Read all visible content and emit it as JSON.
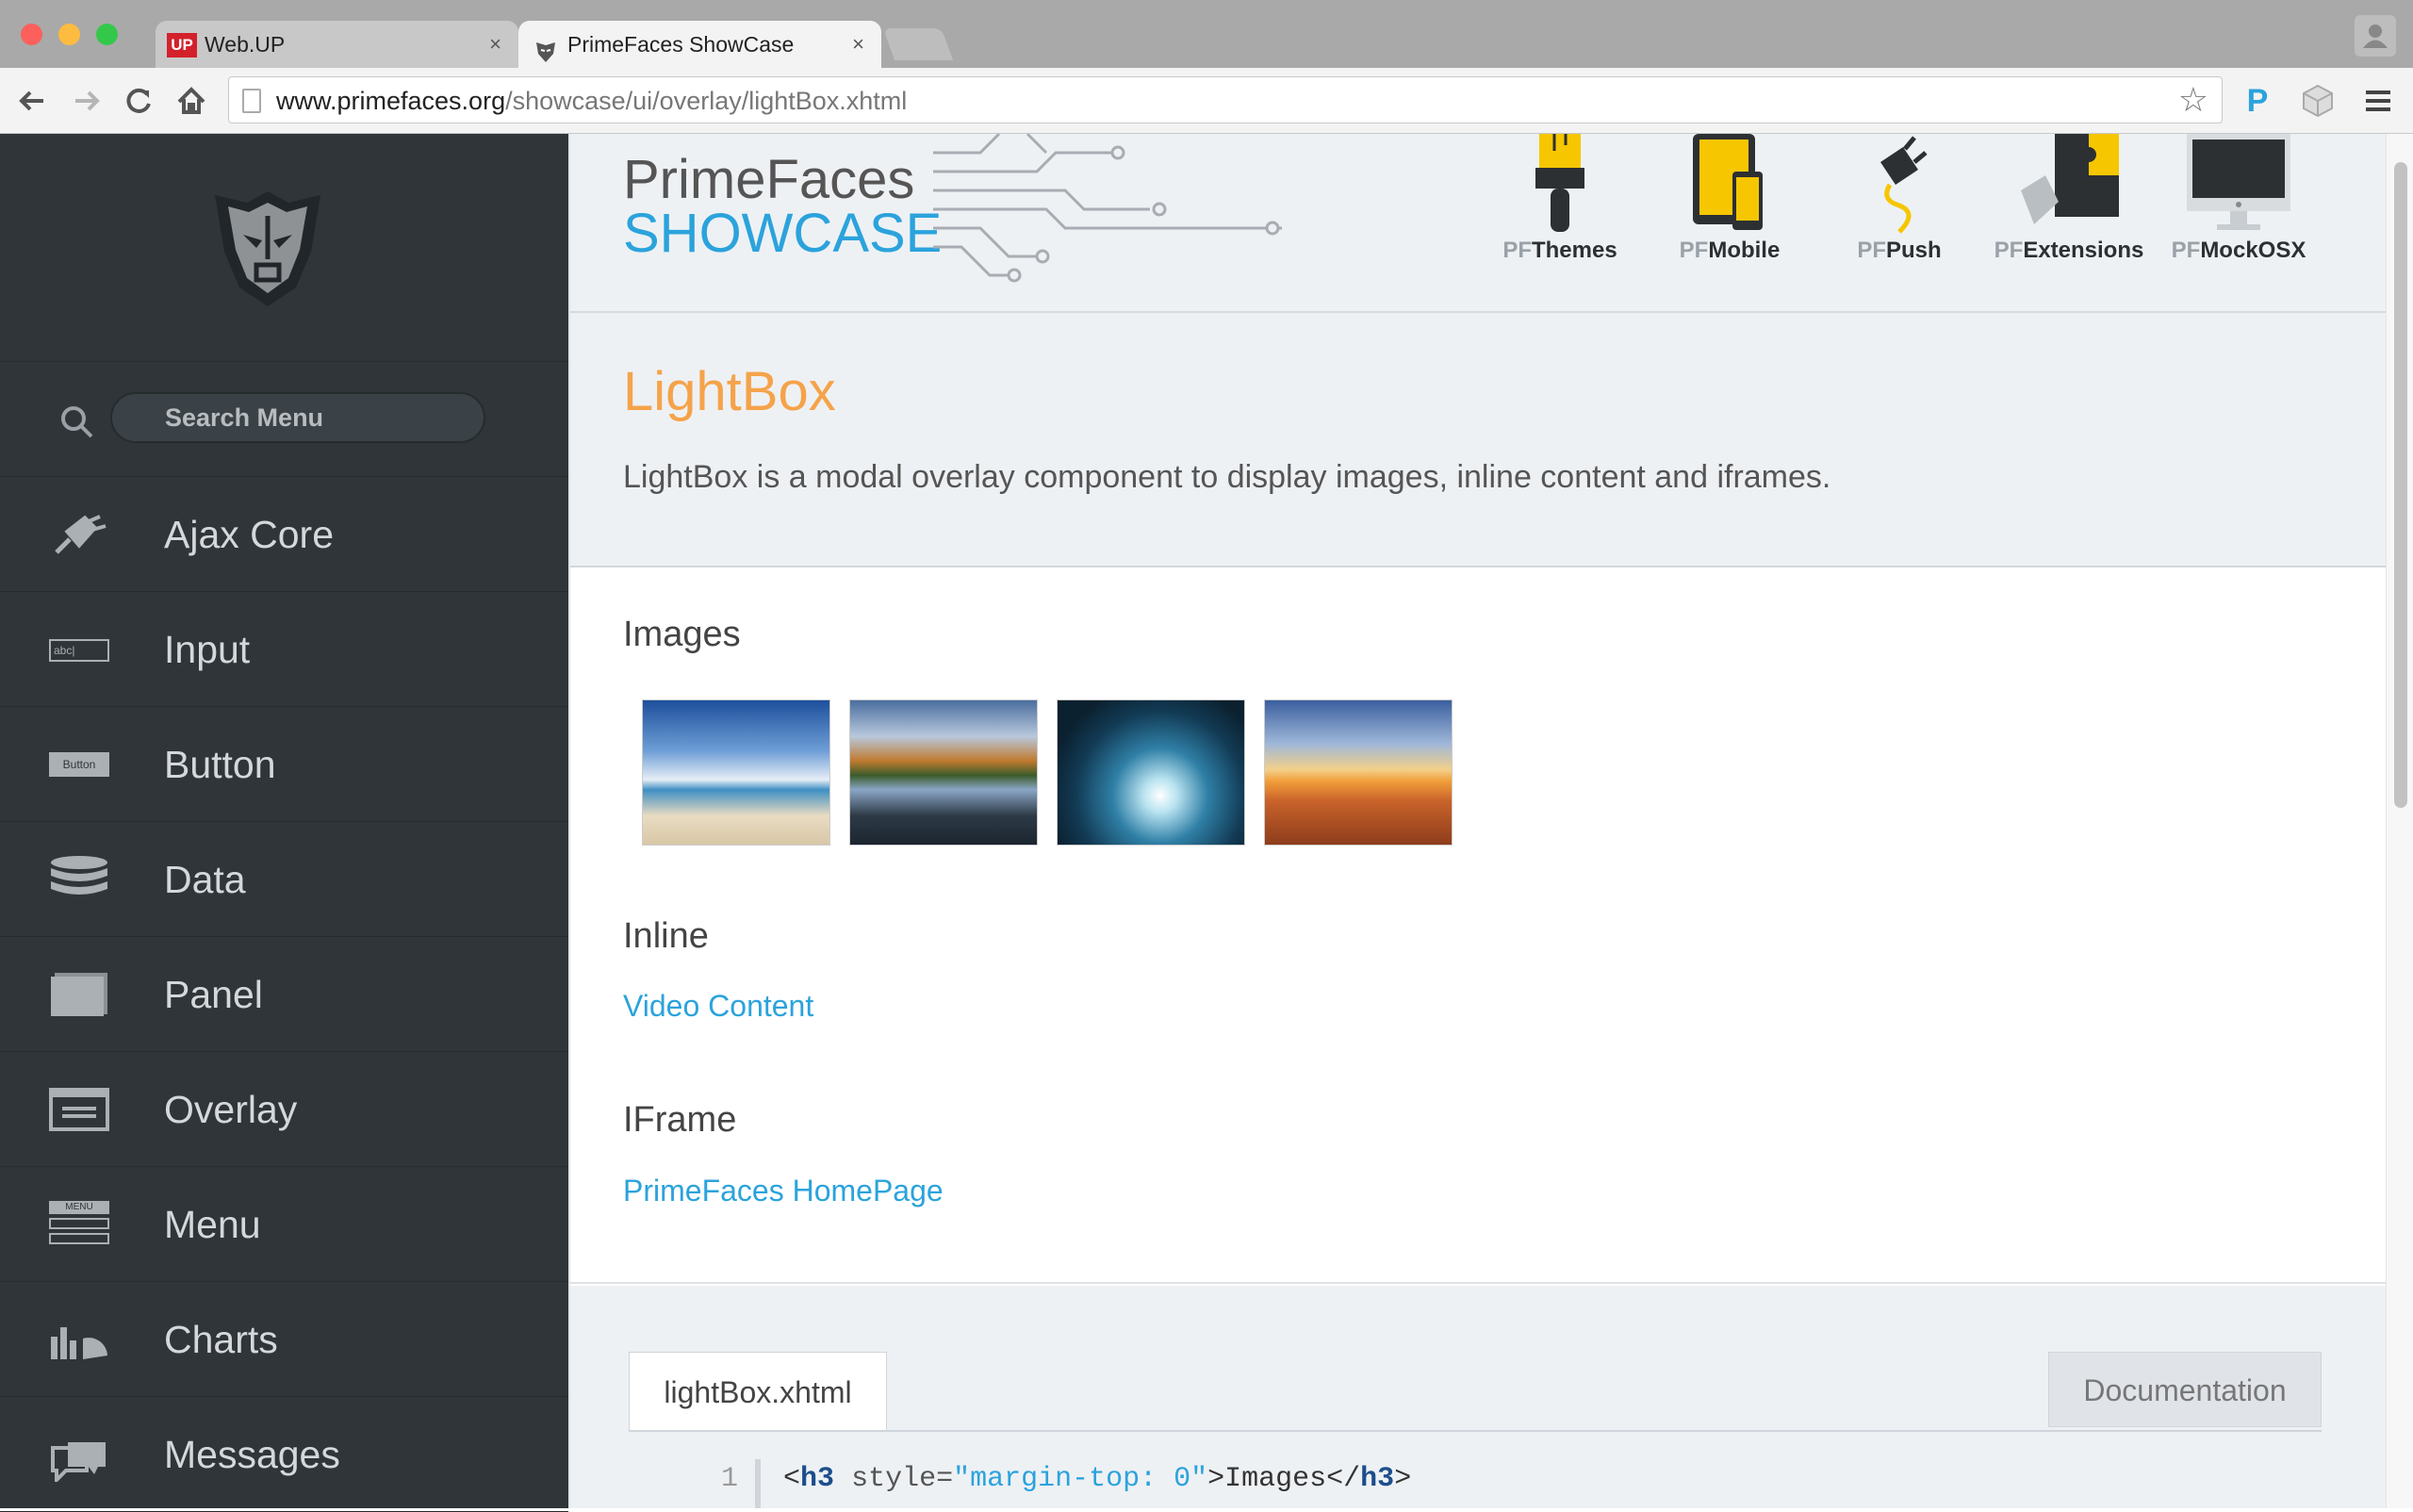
{
  "browser": {
    "tabs": [
      {
        "title": "Web.UP",
        "badge": "UP"
      },
      {
        "title": "PrimeFaces ShowCase"
      }
    ],
    "url_host": "www.primefaces.org",
    "url_path": "/showcase/ui/overlay/lightBox.xhtml",
    "close_glyph": "×",
    "ext_letter": "P"
  },
  "sidebar": {
    "search_placeholder": "Search Menu",
    "items": [
      {
        "label": "Ajax Core",
        "icon": "plug-icon"
      },
      {
        "label": "Input",
        "icon": "input-icon",
        "icon_text": "abc|"
      },
      {
        "label": "Button",
        "icon": "button-icon",
        "icon_text": "Button"
      },
      {
        "label": "Data",
        "icon": "database-icon"
      },
      {
        "label": "Panel",
        "icon": "panel-icon"
      },
      {
        "label": "Overlay",
        "icon": "overlay-icon"
      },
      {
        "label": "Menu",
        "icon": "menu-icon",
        "icon_text": "MENU"
      },
      {
        "label": "Charts",
        "icon": "chart-icon"
      },
      {
        "label": "Messages",
        "icon": "messages-icon"
      }
    ]
  },
  "header": {
    "brand_line1": "PrimeFaces",
    "brand_line2": "SHOWCASE",
    "products": [
      {
        "prefix": "PF",
        "name": "Themes"
      },
      {
        "prefix": "PF",
        "name": "Mobile"
      },
      {
        "prefix": "PF",
        "name": "Push"
      },
      {
        "prefix": "PF",
        "name": "Extensions"
      },
      {
        "prefix": "PF",
        "name": "MockOSX"
      }
    ]
  },
  "page": {
    "title": "LightBox",
    "description": "LightBox is a modal overlay component to display images, inline content and iframes."
  },
  "demo": {
    "images_heading": "Images",
    "inline_heading": "Inline",
    "inline_link": "Video Content",
    "iframe_heading": "IFrame",
    "iframe_link": "PrimeFaces HomePage"
  },
  "code": {
    "tab_source": "lightBox.xhtml",
    "tab_docs": "Documentation",
    "line_number": "1",
    "open_lt": "<",
    "tag": "h3",
    "attr": " style=",
    "value": "\"margin-top: 0\"",
    "content": ">Images</",
    "close_gt": ">"
  },
  "colors": {
    "accent": "#2ba3dc",
    "title": "#f5a34a",
    "sidebar": "#2f3539"
  }
}
